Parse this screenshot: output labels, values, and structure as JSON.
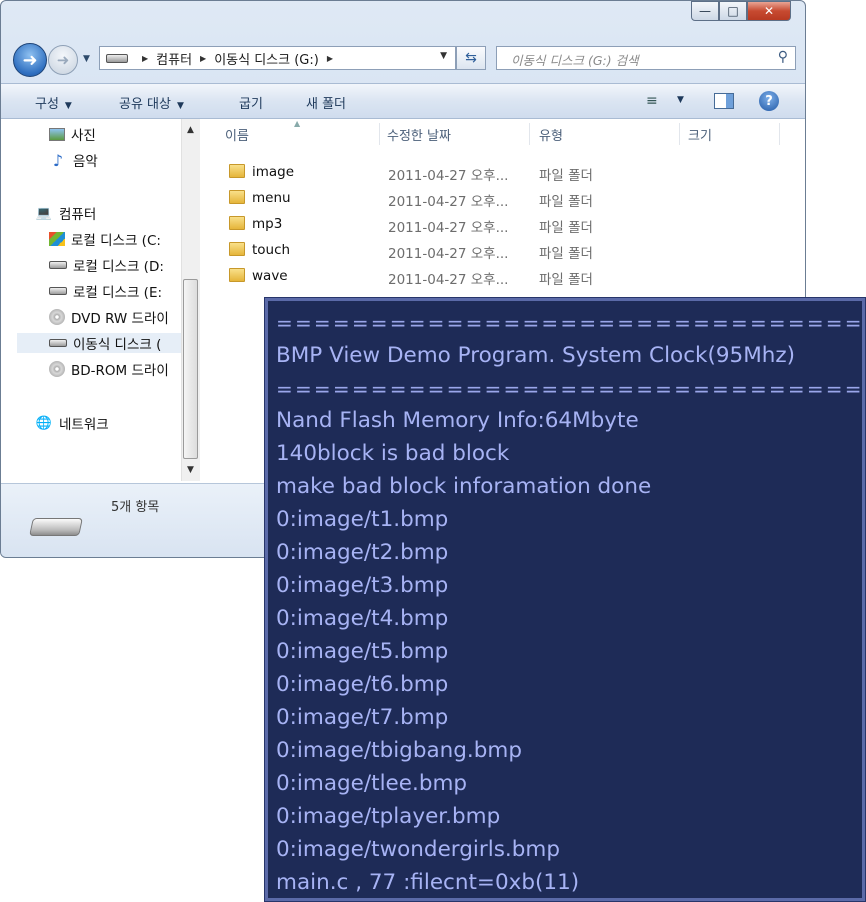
{
  "explorer": {
    "breadcrumb": [
      "컴퓨터",
      "이동식 디스크 (G:)"
    ],
    "search_placeholder": "이동식 디스크 (G:) 검색",
    "toolbar": {
      "organize": "구성",
      "share": "공유 대상",
      "burn": "굽기",
      "new_folder": "새 폴더"
    },
    "nav_pane": {
      "items": [
        {
          "label": "사진",
          "icon": "pictures-icon"
        },
        {
          "label": "음악",
          "icon": "music-icon"
        },
        {
          "label": "컴퓨터",
          "icon": "computer-icon"
        },
        {
          "label": "로컬 디스크 (C:",
          "icon": "windows-drive-icon"
        },
        {
          "label": "로컬 디스크 (D:",
          "icon": "drive-icon"
        },
        {
          "label": "로컬 디스크 (E:",
          "icon": "drive-icon"
        },
        {
          "label": "DVD RW 드라이",
          "icon": "dvd-icon"
        },
        {
          "label": "이동식 디스크 (",
          "icon": "removable-drive-icon"
        },
        {
          "label": "BD-ROM 드라이",
          "icon": "bd-icon"
        },
        {
          "label": "네트워크",
          "icon": "network-icon"
        }
      ]
    },
    "columns": {
      "name": "이름",
      "date": "수정한 날짜",
      "type": "유형",
      "size": "크기"
    },
    "files": [
      {
        "name": "image",
        "date": "2011-04-27 오후...",
        "type": "파일 폴더"
      },
      {
        "name": "menu",
        "date": "2011-04-27 오후...",
        "type": "파일 폴더"
      },
      {
        "name": "mp3",
        "date": "2011-04-27 오후...",
        "type": "파일 폴더"
      },
      {
        "name": "touch",
        "date": "2011-04-27 오후...",
        "type": "파일 폴더"
      },
      {
        "name": "wave",
        "date": "2011-04-27 오후...",
        "type": "파일 폴더"
      }
    ],
    "item_count": "5개 항목"
  },
  "terminal": {
    "lines": [
      "=================================",
      " BMP View Demo Program. System Clock(95Mhz)",
      "=================================",
      "Nand Flash Memory Info:64Mbyte",
      "140block is bad block",
      "make bad block inforamation done",
      "0:image/t1.bmp",
      "0:image/t2.bmp",
      "0:image/t3.bmp",
      "0:image/t4.bmp",
      "0:image/t5.bmp",
      "0:image/t6.bmp",
      "0:image/t7.bmp",
      "0:image/tbigbang.bmp",
      "0:image/tlee.bmp",
      "0:image/tplayer.bmp",
      "0:image/twondergirls.bmp",
      "main.c , 77 :filecnt=0xb(11)"
    ]
  }
}
